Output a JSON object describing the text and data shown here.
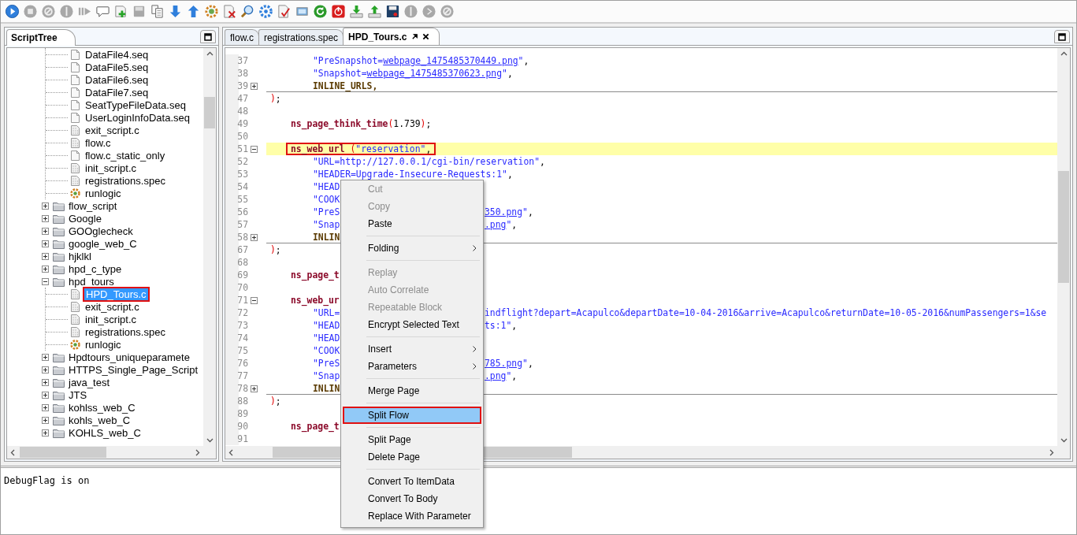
{
  "toolbar": [
    {
      "kind": "play",
      "disabled": false
    },
    {
      "kind": "stop",
      "disabled": true
    },
    {
      "kind": "cancel",
      "disabled": true
    },
    {
      "kind": "pause",
      "disabled": true
    },
    {
      "kind": "step",
      "disabled": true
    },
    {
      "kind": "comment",
      "disabled": false
    },
    {
      "kind": "add_page",
      "disabled": false
    },
    {
      "kind": "save_page",
      "disabled": true
    },
    {
      "kind": "copy",
      "disabled": false
    },
    {
      "kind": "arrow_down",
      "disabled": false
    },
    {
      "kind": "arrow_up",
      "disabled": false
    },
    {
      "kind": "gear_color",
      "disabled": false
    },
    {
      "kind": "doc_delete",
      "disabled": false
    },
    {
      "kind": "search",
      "disabled": false
    },
    {
      "kind": "gear_blue",
      "disabled": false
    },
    {
      "kind": "doc_check",
      "disabled": false
    },
    {
      "kind": "monitor",
      "disabled": false
    },
    {
      "kind": "refresh",
      "disabled": false
    },
    {
      "kind": "power",
      "disabled": false
    },
    {
      "kind": "download",
      "disabled": false
    },
    {
      "kind": "upload",
      "disabled": false
    },
    {
      "kind": "save",
      "disabled": false
    },
    {
      "kind": "pause",
      "disabled": true
    },
    {
      "kind": "next",
      "disabled": true
    },
    {
      "kind": "cancel",
      "disabled": true
    }
  ],
  "script_tree": {
    "title": "ScriptTree",
    "scrolled_branch": [
      {
        "label": "DataFile4.seq",
        "kind": "data",
        "selected": false,
        "annotated": false
      },
      {
        "label": "DataFile5.seq",
        "kind": "data",
        "selected": false,
        "annotated": false
      },
      {
        "label": "DataFile6.seq",
        "kind": "data",
        "selected": false,
        "annotated": false
      },
      {
        "label": "DataFile7.seq",
        "kind": "data",
        "selected": false,
        "annotated": false
      },
      {
        "label": "SeatTypeFileData.seq",
        "kind": "data",
        "selected": false,
        "annotated": false
      },
      {
        "label": "UserLoginInfoData.seq",
        "kind": "data",
        "selected": false,
        "annotated": false
      },
      {
        "label": "exit_script.c",
        "kind": "code",
        "selected": false,
        "annotated": false
      },
      {
        "label": "flow.c",
        "kind": "code",
        "selected": false,
        "annotated": false
      },
      {
        "label": "flow.c_static_only",
        "kind": "data",
        "selected": false,
        "annotated": false
      },
      {
        "label": "init_script.c",
        "kind": "code",
        "selected": false,
        "annotated": false
      },
      {
        "label": "registrations.spec",
        "kind": "code",
        "selected": false,
        "annotated": false
      },
      {
        "label": "runlogic",
        "kind": "logic",
        "selected": false,
        "annotated": false
      }
    ],
    "items": [
      {
        "label": "flow_script",
        "kind": "folder",
        "expanded": false,
        "selected": false,
        "annotated": false
      },
      {
        "label": "Google",
        "kind": "folder",
        "expanded": false,
        "selected": false,
        "annotated": false
      },
      {
        "label": "GOOglecheck",
        "kind": "folder",
        "expanded": false,
        "selected": false,
        "annotated": false
      },
      {
        "label": "google_web_C",
        "kind": "folder",
        "expanded": false,
        "selected": false,
        "annotated": false
      },
      {
        "label": "hjklkl",
        "kind": "folder",
        "expanded": false,
        "selected": false,
        "annotated": false
      },
      {
        "label": "hpd_c_type",
        "kind": "folder",
        "expanded": false,
        "selected": false,
        "annotated": false
      },
      {
        "label": "hpd_tours",
        "kind": "folder",
        "expanded": true,
        "selected": false,
        "annotated": false,
        "children": [
          {
            "label": "HPD_Tours.c",
            "kind": "code",
            "selected": true,
            "annotated": true
          },
          {
            "label": "exit_script.c",
            "kind": "code",
            "selected": false,
            "annotated": false
          },
          {
            "label": "init_script.c",
            "kind": "code",
            "selected": false,
            "annotated": false
          },
          {
            "label": "registrations.spec",
            "kind": "code",
            "selected": false,
            "annotated": false
          },
          {
            "label": "runlogic",
            "kind": "logic",
            "selected": false,
            "annotated": false
          }
        ]
      },
      {
        "label": "Hpdtours_uniqueparamete",
        "kind": "folder",
        "expanded": false,
        "selected": false,
        "annotated": false
      },
      {
        "label": "HTTPS_Single_Page_Script",
        "kind": "folder",
        "expanded": false,
        "selected": false,
        "annotated": false
      },
      {
        "label": "java_test",
        "kind": "folder",
        "expanded": false,
        "selected": false,
        "annotated": false
      },
      {
        "label": "JTS",
        "kind": "folder",
        "expanded": false,
        "selected": false,
        "annotated": false
      },
      {
        "label": "kohlss_web_C",
        "kind": "folder",
        "expanded": false,
        "selected": false,
        "annotated": false
      },
      {
        "label": "kohls_web_C",
        "kind": "folder",
        "expanded": false,
        "selected": false,
        "annotated": false
      },
      {
        "label": "KOHLS_web_C",
        "kind": "folder",
        "expanded": false,
        "selected": false,
        "annotated": false
      }
    ]
  },
  "editor": {
    "tabs": [
      {
        "label": "flow.c",
        "selected": false
      },
      {
        "label": "registrations.spec",
        "selected": false
      },
      {
        "label": "HPD_Tours.c",
        "selected": true
      }
    ],
    "lines": [
      {
        "number": "37",
        "kind": "arg",
        "collapsed": false,
        "expanded": false,
        "current": false,
        "annotated": false,
        "tokens": [
          {
            "kind": "str",
            "text": "\"PreSnapshot="
          },
          {
            "kind": "link",
            "text": "webpage_1475485370449.png"
          },
          {
            "kind": "str",
            "text": "\""
          },
          {
            "kind": "plain",
            "text": ","
          }
        ]
      },
      {
        "number": "38",
        "kind": "arg",
        "collapsed": false,
        "expanded": false,
        "current": false,
        "annotated": false,
        "tokens": [
          {
            "kind": "str",
            "text": "\"Snapshot="
          },
          {
            "kind": "link",
            "text": "webpage_1475485370623.png"
          },
          {
            "kind": "str",
            "text": "\""
          },
          {
            "kind": "plain",
            "text": ","
          }
        ]
      },
      {
        "number": "39",
        "kind": "arg",
        "collapsed": true,
        "expanded": false,
        "current": false,
        "annotated": false,
        "tokens": [
          {
            "kind": "macro",
            "text": "INLINE_URLS,"
          }
        ]
      },
      {
        "number": "47",
        "kind": "end",
        "collapsed": false,
        "expanded": false,
        "current": false,
        "annotated": false,
        "tokens": [
          {
            "kind": "paren",
            "text": ")"
          },
          {
            "kind": "plain",
            "text": ";"
          }
        ]
      },
      {
        "number": "48",
        "kind": "blank",
        "collapsed": false,
        "expanded": false,
        "current": false,
        "annotated": false
      },
      {
        "number": "49",
        "kind": "call",
        "collapsed": false,
        "expanded": false,
        "current": false,
        "annotated": false,
        "tokens": [
          {
            "kind": "kw",
            "text": "ns_page_think_time"
          },
          {
            "kind": "paren",
            "text": "("
          },
          {
            "kind": "plain",
            "text": "1.739"
          },
          {
            "kind": "paren",
            "text": ")"
          },
          {
            "kind": "plain",
            "text": ";"
          }
        ]
      },
      {
        "number": "50",
        "kind": "blank",
        "collapsed": false,
        "expanded": false,
        "current": false,
        "annotated": false
      },
      {
        "number": "51",
        "kind": "call",
        "collapsed": false,
        "expanded": true,
        "current": true,
        "annotated": true,
        "tokens": [
          {
            "kind": "kw",
            "text": "ns_web_url"
          },
          {
            "kind": "paren",
            "text": " ("
          },
          {
            "kind": "str",
            "text": "\"reservation\""
          },
          {
            "kind": "plain",
            "text": ","
          }
        ]
      },
      {
        "number": "52",
        "kind": "arg",
        "collapsed": false,
        "expanded": false,
        "current": false,
        "annotated": false,
        "tokens": [
          {
            "kind": "str",
            "text": "\"URL=http://127.0.0.1/cgi-bin/reservation\""
          },
          {
            "kind": "plain",
            "text": ","
          }
        ]
      },
      {
        "number": "53",
        "kind": "arg",
        "collapsed": false,
        "expanded": false,
        "current": false,
        "annotated": false,
        "tokens": [
          {
            "kind": "str",
            "text": "\"HEADER=Upgrade-Insecure-Requests:1\""
          },
          {
            "kind": "plain",
            "text": ","
          }
        ]
      },
      {
        "number": "54",
        "kind": "arg",
        "collapsed": false,
        "expanded": false,
        "current": false,
        "annotated": false,
        "tokens": [
          {
            "kind": "str",
            "text": "\"HEAD"
          }
        ]
      },
      {
        "number": "55",
        "kind": "arg",
        "collapsed": false,
        "expanded": false,
        "current": false,
        "annotated": false,
        "tokens": [
          {
            "kind": "str",
            "text": "\"COOK"
          }
        ]
      },
      {
        "number": "56",
        "kind": "arg",
        "collapsed": false,
        "expanded": false,
        "current": false,
        "annotated": false,
        "tokens": [
          {
            "kind": "str",
            "text": "\"PreS"
          }
        ],
        "right": [
          {
            "kind": "link",
            "text": "350.png"
          },
          {
            "kind": "str",
            "text": "\""
          },
          {
            "kind": "plain",
            "text": ","
          }
        ]
      },
      {
        "number": "57",
        "kind": "arg",
        "collapsed": false,
        "expanded": false,
        "current": false,
        "annotated": false,
        "tokens": [
          {
            "kind": "str",
            "text": "\"Snap"
          }
        ],
        "right": [
          {
            "kind": "link",
            "text": ".png"
          },
          {
            "kind": "str",
            "text": "\""
          },
          {
            "kind": "plain",
            "text": ","
          }
        ]
      },
      {
        "number": "58",
        "kind": "arg",
        "collapsed": true,
        "expanded": false,
        "current": false,
        "annotated": false,
        "tokens": [
          {
            "kind": "macro",
            "text": "INLIN"
          }
        ]
      },
      {
        "number": "67",
        "kind": "end",
        "collapsed": false,
        "expanded": false,
        "current": false,
        "annotated": false,
        "tokens": [
          {
            "kind": "paren",
            "text": ")"
          },
          {
            "kind": "plain",
            "text": ";"
          }
        ]
      },
      {
        "number": "68",
        "kind": "blank",
        "collapsed": false,
        "expanded": false,
        "current": false,
        "annotated": false
      },
      {
        "number": "69",
        "kind": "call",
        "collapsed": false,
        "expanded": false,
        "current": false,
        "annotated": false,
        "tokens": [
          {
            "kind": "kw",
            "text": "ns_page_t"
          }
        ]
      },
      {
        "number": "70",
        "kind": "blank",
        "collapsed": false,
        "expanded": false,
        "current": false,
        "annotated": false
      },
      {
        "number": "71",
        "kind": "call",
        "collapsed": false,
        "expanded": true,
        "current": false,
        "annotated": false,
        "tokens": [
          {
            "kind": "kw",
            "text": "ns_web_ur"
          }
        ]
      },
      {
        "number": "72",
        "kind": "arg",
        "collapsed": false,
        "expanded": false,
        "current": false,
        "annotated": false,
        "tokens": [
          {
            "kind": "str",
            "text": "\"URL="
          }
        ],
        "right": [
          {
            "kind": "str",
            "text": "indflight?depart=Acapulco&departDate=10-04-2016&arrive=Acapulco&returnDate=10-05-2016&numPassengers=1&se"
          }
        ]
      },
      {
        "number": "73",
        "kind": "arg",
        "collapsed": false,
        "expanded": false,
        "current": false,
        "annotated": false,
        "tokens": [
          {
            "kind": "str",
            "text": "\"HEAD"
          }
        ],
        "right": [
          {
            "kind": "str",
            "text": "ts:1\""
          },
          {
            "kind": "plain",
            "text": ","
          }
        ]
      },
      {
        "number": "74",
        "kind": "arg",
        "collapsed": false,
        "expanded": false,
        "current": false,
        "annotated": false,
        "tokens": [
          {
            "kind": "str",
            "text": "\"HEAD"
          }
        ]
      },
      {
        "number": "75",
        "kind": "arg",
        "collapsed": false,
        "expanded": false,
        "current": false,
        "annotated": false,
        "tokens": [
          {
            "kind": "str",
            "text": "\"COOK"
          }
        ]
      },
      {
        "number": "76",
        "kind": "arg",
        "collapsed": false,
        "expanded": false,
        "current": false,
        "annotated": false,
        "tokens": [
          {
            "kind": "str",
            "text": "\"PreS"
          }
        ],
        "right": [
          {
            "kind": "link",
            "text": "785.png"
          },
          {
            "kind": "str",
            "text": "\""
          },
          {
            "kind": "plain",
            "text": ","
          }
        ]
      },
      {
        "number": "77",
        "kind": "arg",
        "collapsed": false,
        "expanded": false,
        "current": false,
        "annotated": false,
        "tokens": [
          {
            "kind": "str",
            "text": "\"Snap"
          }
        ],
        "right": [
          {
            "kind": "link",
            "text": ".png"
          },
          {
            "kind": "str",
            "text": "\""
          },
          {
            "kind": "plain",
            "text": ","
          }
        ]
      },
      {
        "number": "78",
        "kind": "arg",
        "collapsed": true,
        "expanded": false,
        "current": false,
        "annotated": false,
        "tokens": [
          {
            "kind": "macro",
            "text": "INLIN"
          }
        ]
      },
      {
        "number": "88",
        "kind": "end",
        "collapsed": false,
        "expanded": false,
        "current": false,
        "annotated": false,
        "tokens": [
          {
            "kind": "paren",
            "text": ")"
          },
          {
            "kind": "plain",
            "text": ";"
          }
        ]
      },
      {
        "number": "89",
        "kind": "blank",
        "collapsed": false,
        "expanded": false,
        "current": false,
        "annotated": false
      },
      {
        "number": "90",
        "kind": "call",
        "collapsed": false,
        "expanded": false,
        "current": false,
        "annotated": false,
        "tokens": [
          {
            "kind": "kw",
            "text": "ns_page_t"
          }
        ]
      },
      {
        "number": "91",
        "kind": "blank",
        "collapsed": false,
        "expanded": false,
        "current": false,
        "annotated": false
      }
    ]
  },
  "context_menu": {
    "items": [
      {
        "kind": "item",
        "label": "Cut",
        "disabled": true,
        "submenu": false,
        "selected": false
      },
      {
        "kind": "item",
        "label": "Copy",
        "disabled": true,
        "submenu": false,
        "selected": false
      },
      {
        "kind": "item",
        "label": "Paste",
        "disabled": false,
        "submenu": false,
        "selected": false
      },
      {
        "kind": "separator"
      },
      {
        "kind": "item",
        "label": "Folding",
        "disabled": false,
        "submenu": true,
        "selected": false
      },
      {
        "kind": "separator"
      },
      {
        "kind": "item",
        "label": "Replay",
        "disabled": true,
        "submenu": false,
        "selected": false
      },
      {
        "kind": "item",
        "label": "Auto Correlate",
        "disabled": true,
        "submenu": false,
        "selected": false
      },
      {
        "kind": "item",
        "label": "Repeatable Block",
        "disabled": true,
        "submenu": false,
        "selected": false
      },
      {
        "kind": "item",
        "label": "Encrypt Selected Text",
        "disabled": false,
        "submenu": false,
        "selected": false
      },
      {
        "kind": "separator"
      },
      {
        "kind": "item",
        "label": "Insert",
        "disabled": false,
        "submenu": true,
        "selected": false
      },
      {
        "kind": "item",
        "label": "Parameters",
        "disabled": false,
        "submenu": true,
        "selected": false
      },
      {
        "kind": "separator"
      },
      {
        "kind": "item",
        "label": "Merge Page",
        "disabled": false,
        "submenu": false,
        "selected": false
      },
      {
        "kind": "separator"
      },
      {
        "kind": "item",
        "label": "Split Flow",
        "disabled": false,
        "submenu": false,
        "selected": true
      },
      {
        "kind": "separator"
      },
      {
        "kind": "item",
        "label": "Split Page",
        "disabled": false,
        "submenu": false,
        "selected": false
      },
      {
        "kind": "item",
        "label": "Delete Page",
        "disabled": false,
        "submenu": false,
        "selected": false
      },
      {
        "kind": "separator"
      },
      {
        "kind": "item",
        "label": "Convert To ItemData",
        "disabled": false,
        "submenu": false,
        "selected": false
      },
      {
        "kind": "item",
        "label": "Convert To Body",
        "disabled": false,
        "submenu": false,
        "selected": false
      },
      {
        "kind": "item",
        "label": "Replace With Parameter",
        "disabled": false,
        "submenu": false,
        "selected": false
      }
    ]
  },
  "console": {
    "text": "DebugFlag is on"
  }
}
